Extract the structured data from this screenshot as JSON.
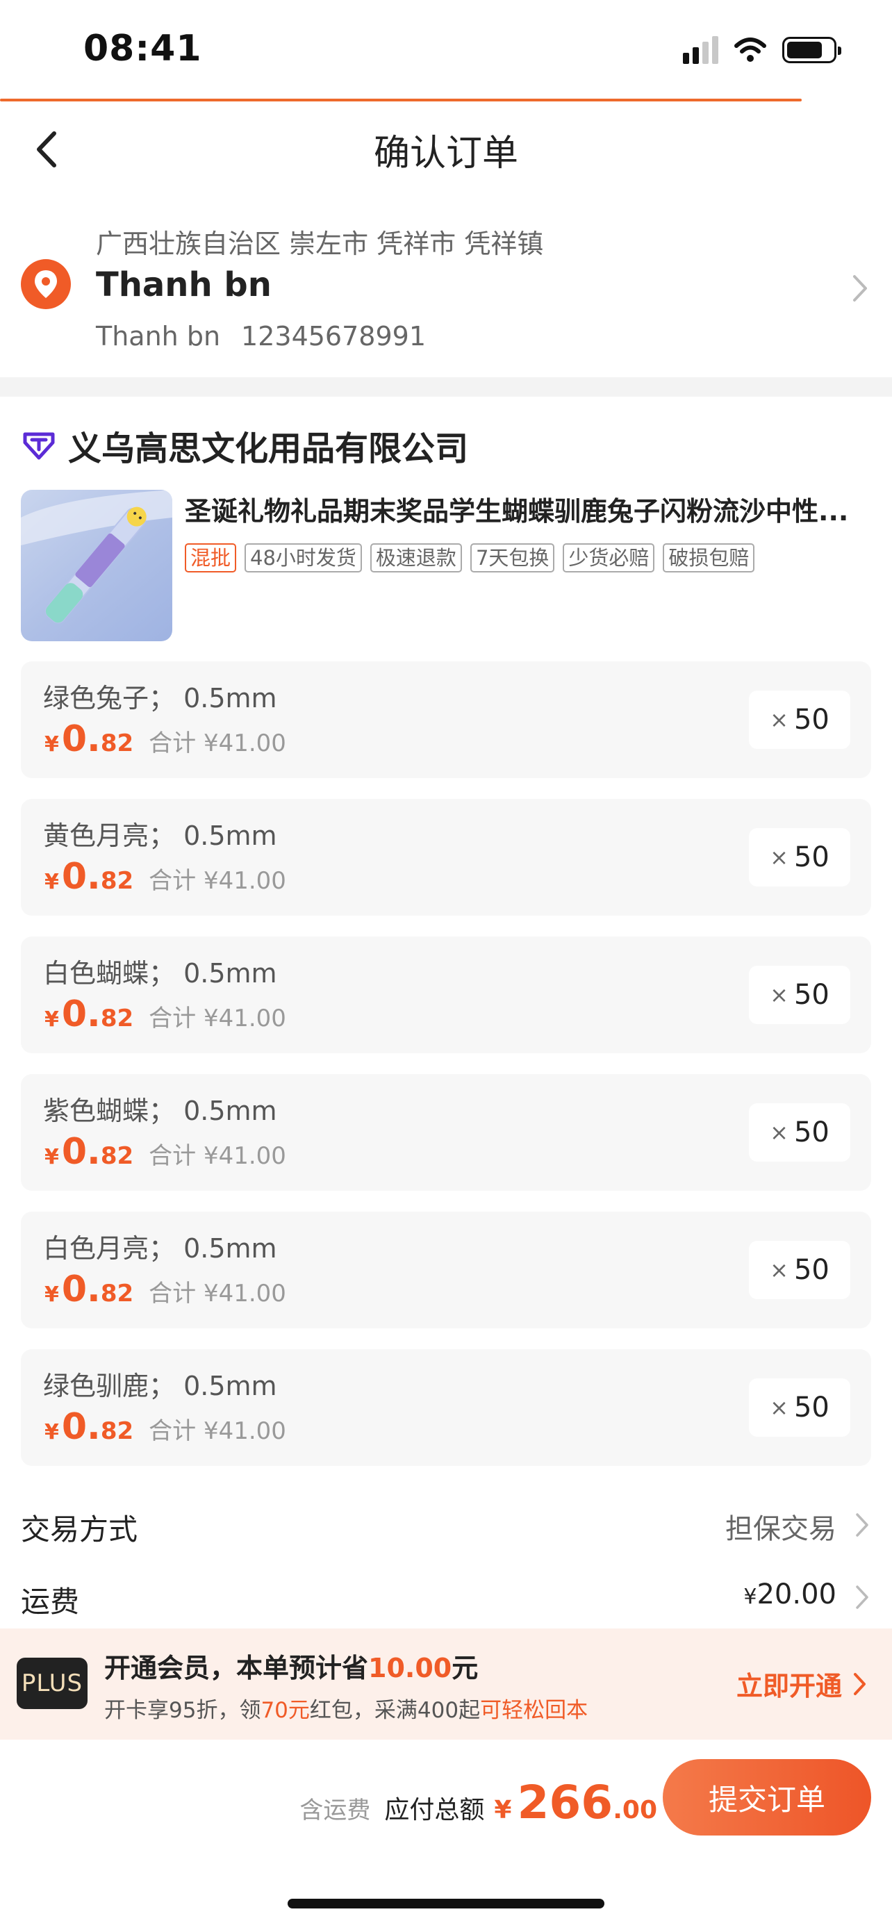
{
  "status": {
    "time": "08:41"
  },
  "nav": {
    "title": "确认订单"
  },
  "address": {
    "region": "广西壮族自治区 崇左市 凭祥市 凭祥镇",
    "name": "Thanh bn",
    "contact_name": "Thanh bn",
    "phone": "12345678991"
  },
  "store": {
    "name": "义乌高思文化用品有限公司"
  },
  "product": {
    "title": "圣诞礼物礼品期末奖品学生蝴蝶驯鹿兔子闪粉流沙中性...",
    "tags": [
      "混批",
      "48小时发货",
      "极速退款",
      "7天包换",
      "少货必赔",
      "破损包赔"
    ]
  },
  "variants": [
    {
      "name": "绿色兔子； 0.5mm",
      "yen": "¥",
      "price_int": "0.",
      "price_dec": "82",
      "total": "合计 ¥41.00",
      "x": "×",
      "qty": "50"
    },
    {
      "name": "黄色月亮； 0.5mm",
      "yen": "¥",
      "price_int": "0.",
      "price_dec": "82",
      "total": "合计 ¥41.00",
      "x": "×",
      "qty": "50"
    },
    {
      "name": "白色蝴蝶； 0.5mm",
      "yen": "¥",
      "price_int": "0.",
      "price_dec": "82",
      "total": "合计 ¥41.00",
      "x": "×",
      "qty": "50"
    },
    {
      "name": "紫色蝴蝶； 0.5mm",
      "yen": "¥",
      "price_int": "0.",
      "price_dec": "82",
      "total": "合计 ¥41.00",
      "x": "×",
      "qty": "50"
    },
    {
      "name": "白色月亮； 0.5mm",
      "yen": "¥",
      "price_int": "0.",
      "price_dec": "82",
      "total": "合计 ¥41.00",
      "x": "×",
      "qty": "50"
    },
    {
      "name": "绿色驯鹿； 0.5mm",
      "yen": "¥",
      "price_int": "0.",
      "price_dec": "82",
      "total": "合计 ¥41.00",
      "x": "×",
      "qty": "50"
    }
  ],
  "trade": {
    "label": "交易方式",
    "value": "担保交易"
  },
  "shipping": {
    "label": "运费",
    "yen": "¥",
    "value": "20.00"
  },
  "plus": {
    "badge": "PLUS",
    "title_pre": "开通会员，本单预计省",
    "title_amount": "10.00",
    "title_post": "元",
    "sub_1": "开卡享95折，领",
    "sub_2": "70元",
    "sub_3": "红包，采满400起",
    "sub_4": "可轻松回本",
    "cta": "立即开通"
  },
  "footer": {
    "note": "含运费",
    "label": "应付总额",
    "yen": "¥",
    "total_int": "266",
    "total_dec": ".00",
    "submit": "提交订单"
  },
  "colors": {
    "accent": "#f05b27",
    "background_band": "#f3f3f3",
    "variant_bg": "#f7f7f7",
    "plus_bg": "#fdf0ea"
  }
}
